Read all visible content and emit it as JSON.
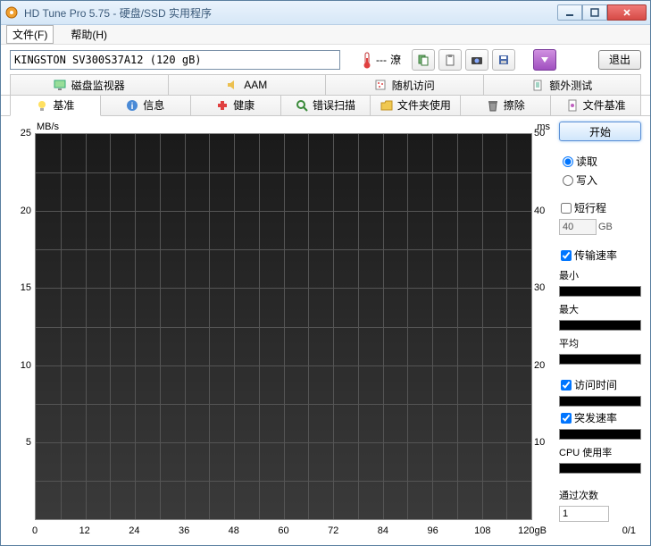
{
  "window": {
    "title": "HD Tune Pro 5.75 - 硬盘/SSD 实用程序"
  },
  "menu": {
    "file": "文件(F)",
    "help": "帮助(H)"
  },
  "toolbar": {
    "drive": "KINGSTON SV300S37A12 (120 gB)",
    "temp_dashes": "---",
    "temp_unit": "潦",
    "exit": "退出"
  },
  "tabs_top": {
    "disk_monitor": "磁盘监视器",
    "aam": "AAM",
    "random_access": "随机访问",
    "extra": "额外测试"
  },
  "tabs_sub": {
    "benchmark": "基准",
    "info": "信息",
    "health": "健康",
    "error_scan": "错误扫描",
    "folder_usage": "文件夹使用",
    "erase": "擦除",
    "file_benchmark": "文件基准"
  },
  "side": {
    "start": "开始",
    "read": "读取",
    "write": "写入",
    "short_stroke": "短行程",
    "short_stroke_value": "40",
    "short_stroke_unit": "GB",
    "transfer_rate": "传输速率",
    "min": "最小",
    "max": "最大",
    "avg": "平均",
    "access_time": "访问时间",
    "burst_rate": "突发速率",
    "cpu_usage": "CPU 使用率",
    "passes": "通过次数",
    "passes_value": "1",
    "pass_counter": "0/1"
  },
  "chart_data": {
    "type": "line",
    "y_left_label": "MB/s",
    "y_right_label": "ms",
    "y_left_ticks": [
      25,
      20,
      15,
      10,
      5
    ],
    "y_right_ticks": [
      50,
      40,
      30,
      20,
      10
    ],
    "x_ticks": [
      "0",
      "12",
      "24",
      "36",
      "48",
      "60",
      "72",
      "84",
      "96",
      "108",
      "120gB"
    ],
    "series": [],
    "ylim_left": [
      0,
      25
    ],
    "ylim_right": [
      0,
      50
    ],
    "xlim": [
      0,
      120
    ]
  }
}
